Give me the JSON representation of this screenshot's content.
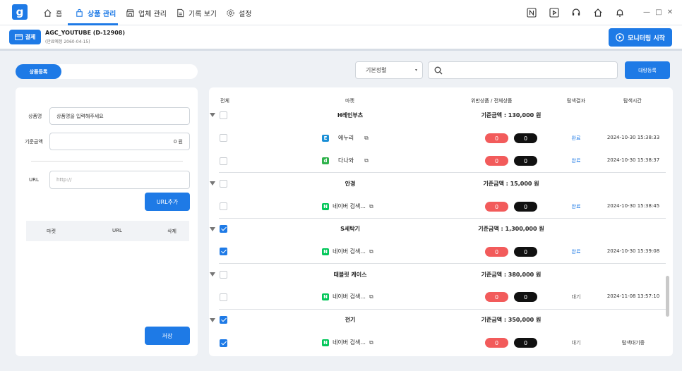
{
  "nav": {
    "logo": "g",
    "items": [
      {
        "label": "홈",
        "icon": "home-icon"
      },
      {
        "label": "상품 관리",
        "icon": "bag-icon"
      },
      {
        "label": "업체 관리",
        "icon": "store-icon"
      },
      {
        "label": "기록 보기",
        "icon": "document-icon"
      },
      {
        "label": "설정",
        "icon": "gear-icon"
      }
    ],
    "active_index": 1
  },
  "header": {
    "pay_label": "결제",
    "account": "AGC_YOUTUBE (D-12908)",
    "expiry": "(만료예정 2060-04-15)",
    "monitor_label": "모니터링 시작"
  },
  "toolbar": {
    "tab_label": "상품등록",
    "sort_value": "기본정렬",
    "search_placeholder": "",
    "bulk_label": "대량등록"
  },
  "form": {
    "name_label": "상품명",
    "name_placeholder": "상품명을 입력해주세요",
    "price_label": "기준금액",
    "price_value": "0 원",
    "url_label": "URL",
    "url_placeholder": "http://",
    "url_add_label": "URL추가",
    "url_cols": [
      "마켓",
      "URL",
      "삭제"
    ],
    "save_label": "저장"
  },
  "table": {
    "headers": [
      "전체",
      "마켓",
      "위반상품 / 전체상품",
      "탐색결과",
      "탐색시간"
    ],
    "groups": [
      {
        "name": "H레인부츠",
        "price": "기준금액 : 130,000 원",
        "checked": false,
        "rows": [
          {
            "market": "에누리",
            "icon": "E",
            "icon_color": "#1a8fd6",
            "violations": "0",
            "total": "0",
            "status": "완료",
            "time": "2024-10-30 15:38:33",
            "checked": false
          },
          {
            "market": "다나와",
            "icon": "d",
            "icon_color": "#2fb24c",
            "violations": "0",
            "total": "0",
            "status": "완료",
            "time": "2024-10-30 15:38:37",
            "checked": false
          }
        ]
      },
      {
        "name": "안경",
        "price": "기준금액 : 15,000 원",
        "checked": false,
        "rows": [
          {
            "market": "네이버 검색...",
            "icon": "N",
            "icon_color": "#03c75a",
            "violations": "0",
            "total": "0",
            "status": "완료",
            "time": "2024-10-30 15:38:45",
            "checked": false
          }
        ]
      },
      {
        "name": "S세탁기",
        "price": "기준금액 : 1,300,000 원",
        "checked": true,
        "rows": [
          {
            "market": "네이버 검색...",
            "icon": "N",
            "icon_color": "#03c75a",
            "violations": "0",
            "total": "0",
            "status": "완료",
            "time": "2024-10-30 15:39:08",
            "checked": true
          }
        ]
      },
      {
        "name": "태블릿 케이스",
        "price": "기준금액 : 380,000 원",
        "checked": false,
        "rows": [
          {
            "market": "네이버 검색...",
            "icon": "N",
            "icon_color": "#03c75a",
            "violations": "0",
            "total": "0",
            "status": "대기",
            "time": "2024-11-08 13:57:10",
            "checked": false
          }
        ]
      },
      {
        "name": "전기",
        "price": "기준금액 : 350,000 원",
        "checked": true,
        "rows": [
          {
            "market": "네이버 검색...",
            "icon": "N",
            "icon_color": "#03c75a",
            "violations": "0",
            "total": "0",
            "status": "대기",
            "time": "탐색대기중",
            "checked": true
          }
        ]
      }
    ]
  },
  "colors": {
    "accent": "#1e7ae6",
    "danger": "#f25b5b"
  }
}
